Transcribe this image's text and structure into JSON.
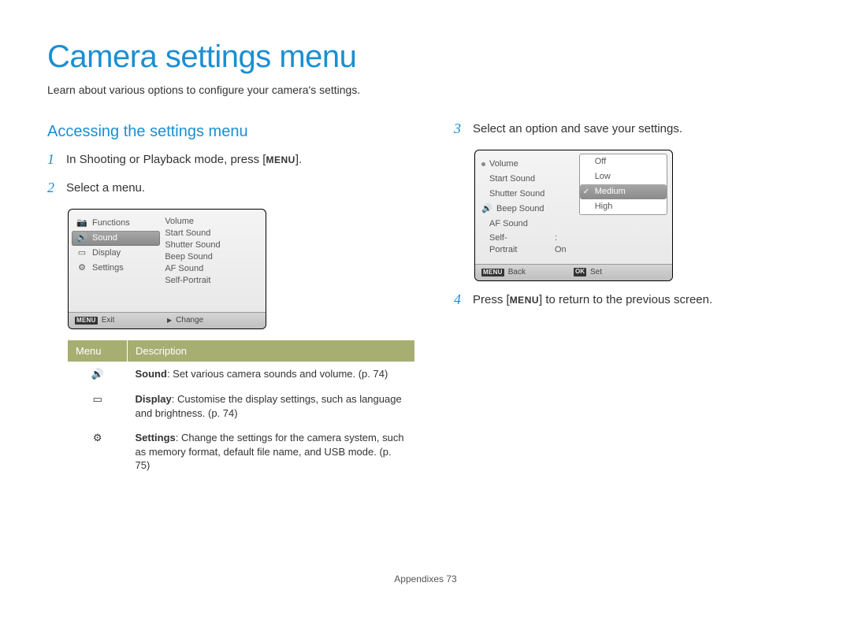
{
  "page": {
    "title": "Camera settings menu",
    "subtitle": "Learn about various options to configure your camera's settings.",
    "footer_section": "Appendixes",
    "footer_page": "73"
  },
  "section_heading": "Accessing the settings menu",
  "steps": {
    "1": {
      "pre": "In Shooting or Playback mode, press [",
      "btn": "MENU",
      "post": "]."
    },
    "2": "Select a menu.",
    "3": "Select an option and save your settings.",
    "4": {
      "pre": "Press [",
      "btn": "MENU",
      "post": "] to return to the previous screen."
    }
  },
  "screenshot1": {
    "left": [
      "Functions",
      "Sound",
      "Display",
      "Settings"
    ],
    "right": [
      "Volume",
      "Start Sound",
      "Shutter Sound",
      "Beep Sound",
      "AF Sound",
      "Self-Portrait"
    ],
    "footer_left_btn": "MENU",
    "footer_left": "Exit",
    "footer_right_sym": "▶",
    "footer_right": "Change"
  },
  "screenshot2": {
    "left": [
      "Volume",
      "Start Sound",
      "Shutter Sound",
      "Beep Sound",
      "AF Sound",
      "Self-Portrait"
    ],
    "left_extra": ": On",
    "right": [
      "Off",
      "Low",
      "Medium",
      "High"
    ],
    "footer_left_btn": "MENU",
    "footer_left": "Back",
    "footer_right_btn": "OK",
    "footer_right": "Set"
  },
  "table": {
    "headers": [
      "Menu",
      "Description"
    ],
    "rows": [
      {
        "bold": "Sound",
        "rest": ": Set various camera sounds and volume. (p. 74)"
      },
      {
        "bold": "Display",
        "rest": ": Customise the display settings, such as language and brightness. (p. 74)"
      },
      {
        "bold": "Settings",
        "rest": ": Change the settings for the camera system, such as memory format, default file name, and USB mode. (p. 75)"
      }
    ]
  }
}
